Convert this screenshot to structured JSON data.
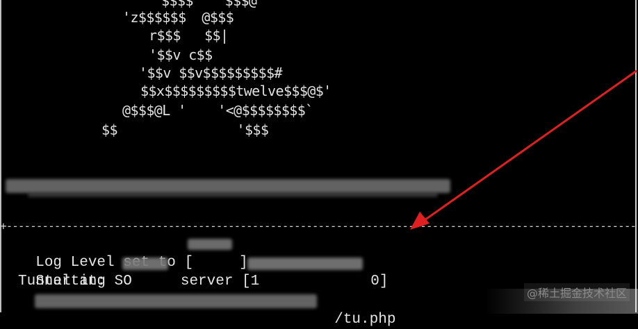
{
  "terminal": {
    "ascii_art": [
      "$$$$    $$$@",
      "'z$$$$$$  @$$$",
      "r$$$   $$|",
      "'$$v c$$",
      "'$$v $$v$$$$$$$$$#",
      "$$x$$$$$$$$$twelve$$$@$'",
      "@$$$@L '    '<@$$$$$$$$`",
      "$$               '$$$"
    ],
    "divider": "+-------------------------------------------------------------------------------------------------------------------------------------",
    "log_level_label": "Log Level set to [",
    "log_level_close": "]",
    "starting_label": "Starting SO",
    "starting_server": "server [1",
    "starting_close": "0]",
    "tunnel_label": "Tunnel at:",
    "tunnel_suffix": "/tu.php"
  },
  "watermark": "@稀土掘金技术社区",
  "annotation": {
    "arrow_color": "#e02020"
  }
}
